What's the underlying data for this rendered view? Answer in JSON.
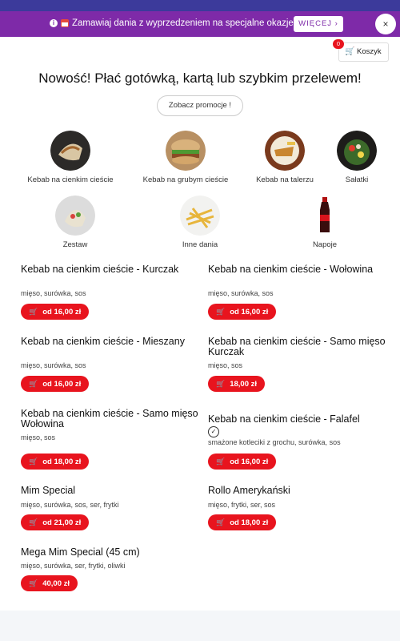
{
  "promo_bar": {
    "info_icon": "info-icon",
    "calendar_icon": "calendar-icon",
    "text": "Zamawiaj dania z wyprzedzeniem na specjalne okazje!",
    "more_label": "WIĘCEJ ›",
    "close_label": "×"
  },
  "cart": {
    "label": "Koszyk",
    "count": "0"
  },
  "headline": "Nowość! Płać gotówką, kartą lub szybkim przelewem!",
  "promotions_button": "Zobacz promocje !",
  "categories": [
    {
      "label": "Kebab na cienkim cieście"
    },
    {
      "label": "Kebab na grubym cieście"
    },
    {
      "label": "Kebab na talerzu"
    },
    {
      "label": "Sałatki"
    },
    {
      "label": "Zestaw"
    },
    {
      "label": "Inne dania"
    },
    {
      "label": "Napoje"
    }
  ],
  "menu_items": [
    {
      "name": "Kebab na cienkim cieście - Kurczak",
      "desc": "mięso, surówka, sos",
      "price": "od 16,00 zł"
    },
    {
      "name": "Kebab na cienkim cieście - Wołowina",
      "desc": "mięso, surówka, sos",
      "price": "od 16,00 zł"
    },
    {
      "name": "Kebab na cienkim cieście - Mieszany",
      "desc": "mięso, surówka, sos",
      "price": "od 16,00 zł"
    },
    {
      "name": "Kebab na cienkim cieście - Samo mięso Kurczak",
      "desc": "mięso, sos",
      "price": "18,00 zł"
    },
    {
      "name": "Kebab na cienkim cieście - Samo mięso Wołowina",
      "desc": "mięso, sos",
      "price": "od 18,00 zł"
    },
    {
      "name": "Kebab na cienkim cieście - Falafel",
      "desc": "smażone kotleciki z grochu, surówka, sos",
      "price": "od 16,00 zł"
    },
    {
      "name": "Mim Special",
      "desc": "mięso, surówka, sos, ser, frytki",
      "price": "od 21,00 zł"
    },
    {
      "name": "Rollo Amerykański",
      "desc": "mięso, frytki, ser, sos",
      "price": "od 18,00 zł"
    },
    {
      "name": "Mega Mim Special (45 cm)",
      "desc": "mięso, surówka, ser, frytki, oliwki",
      "price": "40,00 zł"
    }
  ],
  "colors": {
    "top": "#3c3a9b",
    "promo": "#7e2aa8",
    "price": "#e8141e"
  }
}
